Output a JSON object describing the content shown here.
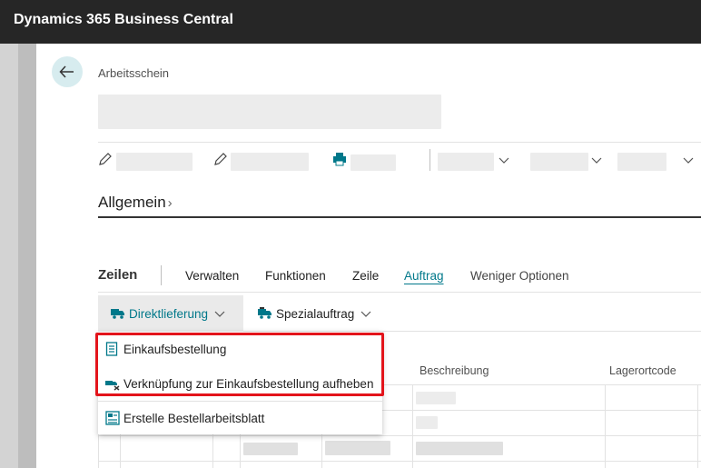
{
  "app": {
    "title": "Dynamics 365 Business Central"
  },
  "page": {
    "breadcrumb": "Arbeitsschein"
  },
  "section": {
    "title": "Allgemein",
    "chevron": "›"
  },
  "lines": {
    "caption": "Zeilen",
    "tabs": [
      {
        "label": "Verwalten"
      },
      {
        "label": "Funktionen"
      },
      {
        "label": "Zeile"
      },
      {
        "label": "Auftrag",
        "active": true
      },
      {
        "label": "Weniger Optionen"
      }
    ],
    "subbar": {
      "direktlieferung": "Direktlieferung",
      "spezialauftrag": "Spezialauftrag"
    },
    "columns": {
      "beschreibung": "Beschreibung",
      "lagerortcode": "Lagerortcode"
    }
  },
  "dropdown": {
    "items": [
      {
        "label": "Einkaufsbestellung",
        "icon": "purchase-order-icon"
      },
      {
        "label": "Verknüpfung zur Einkaufsbestellung aufheben",
        "icon": "unlink-icon"
      },
      {
        "label": "Erstelle Bestellarbeitsblatt",
        "icon": "worksheet-icon"
      }
    ]
  },
  "colors": {
    "accent": "#00788a",
    "highlight": "#e3141b",
    "topbar": "#262626"
  }
}
